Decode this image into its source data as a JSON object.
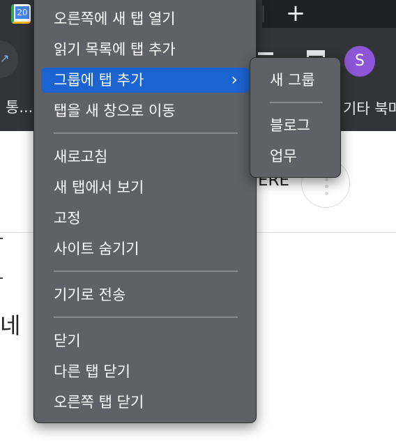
{
  "tabstrip": {
    "calendar_favicon_text": "20",
    "new_tab_symbol": "+"
  },
  "toolbar": {
    "bookmark_left_label": "통...",
    "bookmark_right_label": "기타 북마",
    "profile_initial": "S",
    "profile_color": "#8e55d6"
  },
  "page": {
    "partial_text": "ERE",
    "partial_glyph": "네"
  },
  "context_menu": {
    "items": [
      {
        "label": "오른쪽에 새 탭 열기"
      },
      {
        "label": "읽기 목록에 탭 추가"
      },
      {
        "label": "그룹에 탭 추가",
        "submenu_indicator": "›"
      },
      {
        "label": "탭을 새 창으로 이동"
      },
      {
        "label": "새로고침"
      },
      {
        "label": "새 탭에서 보기"
      },
      {
        "label": "고정"
      },
      {
        "label": "사이트 숨기기"
      },
      {
        "label": "기기로 전송"
      },
      {
        "label": "닫기"
      },
      {
        "label": "다른 탭 닫기"
      },
      {
        "label": "오른쪽 탭 닫기"
      }
    ],
    "highlight_color": "#1c63d2",
    "background_color": "#606166"
  },
  "submenu": {
    "items": [
      {
        "label": "새 그룹"
      },
      {
        "label": "블로그"
      },
      {
        "label": "업무"
      }
    ]
  }
}
